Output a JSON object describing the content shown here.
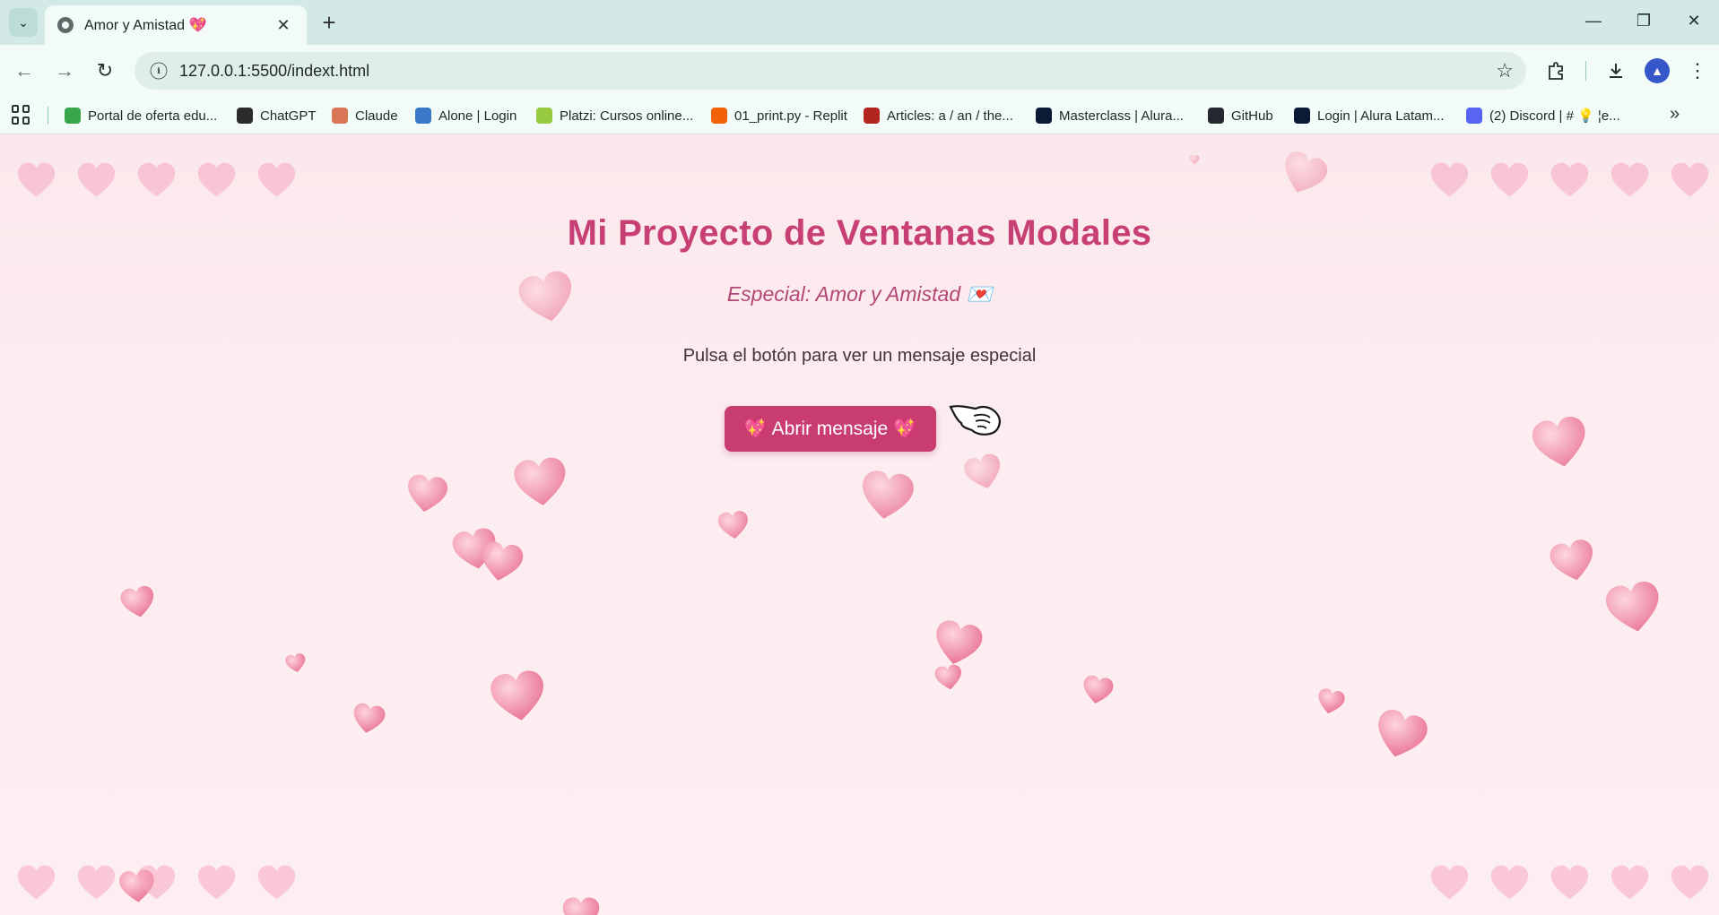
{
  "browser": {
    "tab_title": "Amor y Amistad 💖",
    "url": "127.0.0.1:5500/indext.html",
    "bookmarks": [
      {
        "label": "Portal de oferta edu...",
        "color": "#3aa64c"
      },
      {
        "label": "ChatGPT",
        "color": "#2b2b2b"
      },
      {
        "label": "Claude",
        "color": "#d97757"
      },
      {
        "label": "Alone | Login",
        "color": "#3c78c8"
      },
      {
        "label": "Platzi: Cursos online...",
        "color": "#98ca3f"
      },
      {
        "label": "01_print.py - Replit",
        "color": "#f26207"
      },
      {
        "label": "Articles: a / an / the...",
        "color": "#b3261e"
      },
      {
        "label": "Masterclass | Alura...",
        "color": "#0b1b35"
      },
      {
        "label": "GitHub",
        "color": "#24292f"
      },
      {
        "label": "Login | Alura Latam...",
        "color": "#0b1b35"
      },
      {
        "label": "(2) Discord | # 💡 ¦e...",
        "color": "#5865f2"
      }
    ]
  },
  "page": {
    "title": "Mi Proyecto de Ventanas Modales",
    "subtitle": "Especial: Amor y Amistad 💌",
    "instruction": "Pulsa el botón para ver un mensaje especial",
    "button_label": "💖 Abrir mensaje 💖"
  },
  "colors": {
    "accent": "#c83c70",
    "title": "#c73f73",
    "background": "#fdeef1"
  }
}
